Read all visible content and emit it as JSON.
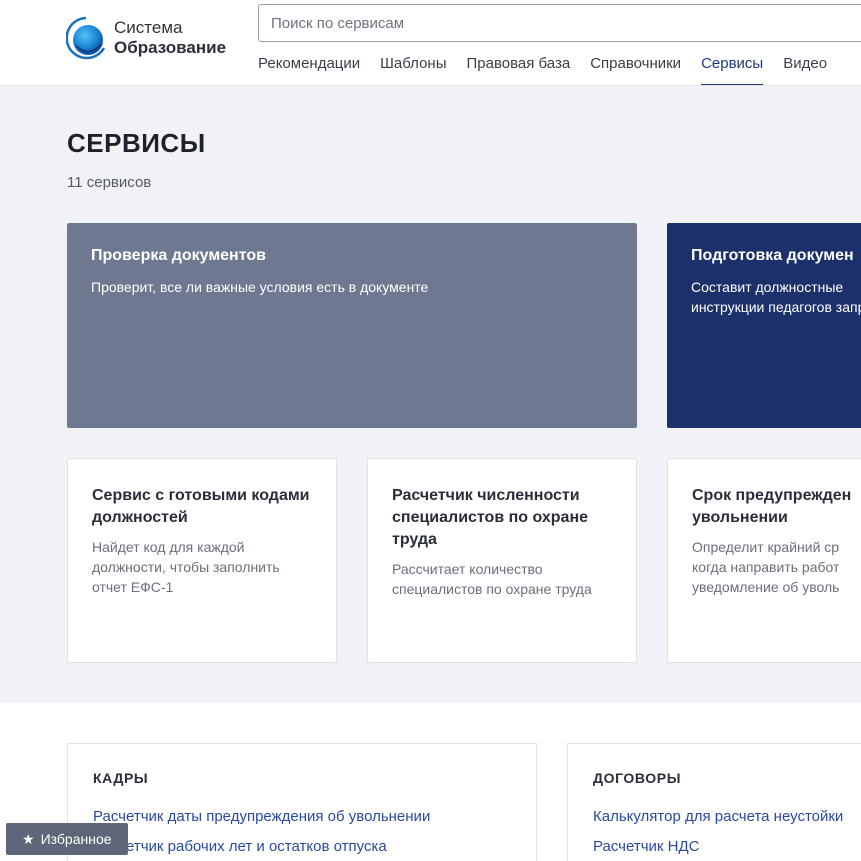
{
  "logo": {
    "line1": "Система",
    "line2": "Образование"
  },
  "search": {
    "placeholder": "Поиск по сервисам"
  },
  "nav": [
    {
      "label": "Рекомендации",
      "active": false
    },
    {
      "label": "Шаблоны",
      "active": false
    },
    {
      "label": "Правовая база",
      "active": false
    },
    {
      "label": "Справочники",
      "active": false
    },
    {
      "label": "Сервисы",
      "active": true
    },
    {
      "label": "Видео",
      "active": false
    }
  ],
  "page": {
    "title": "СЕРВИСЫ",
    "count": "11 сервисов"
  },
  "featured": [
    {
      "title": "Проверка документов",
      "desc": "Проверит, все ли важные условия есть в документе",
      "color": "#6f7891"
    },
    {
      "title": "Подготовка докумен",
      "desc": "Составит должностные инструкции педагогов запросу",
      "color": "#1c316b"
    }
  ],
  "cards": [
    {
      "title": "Сервис с готовыми кодами должностей",
      "desc": "Найдет код для каждой должности, чтобы заполнить отчет ЕФС-1"
    },
    {
      "title": "Расчетчик численности специалистов по охране труда",
      "desc": "Рассчитает количество специалистов по охране труда"
    },
    {
      "title": "Срок предупрежден увольнении",
      "desc": "Определит крайний ср когда направить работ уведомление об уволь"
    }
  ],
  "panels": [
    {
      "title": "КАДРЫ",
      "links": [
        "Расчетчик даты предупреждения об увольнении",
        "Расчетчик рабочих лет и остатков отпуска"
      ]
    },
    {
      "title": "ДОГОВОРЫ",
      "links": [
        "Калькулятор для расчета неустойки",
        "Расчетчик НДС"
      ]
    }
  ],
  "favorites": {
    "label": "Избранное",
    "icon": "star-icon"
  },
  "colors": {
    "accent": "#1f3a7a",
    "link": "#2a4a9c"
  }
}
